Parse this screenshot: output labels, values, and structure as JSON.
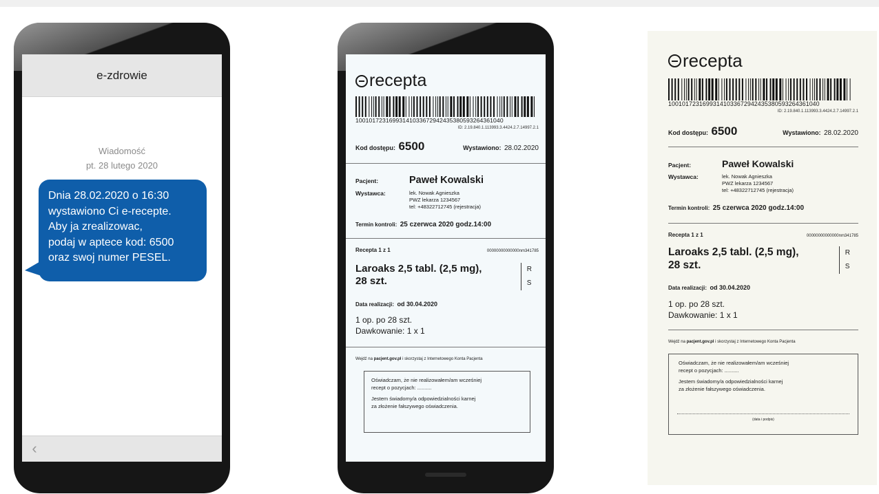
{
  "sms": {
    "header_title": "e-zdrowie",
    "meta_label": "Wiadomość",
    "meta_date": "pt. 28 lutego 2020",
    "message_lines": [
      "Dnia 28.02.2020 o 16:30",
      "wystawiono Ci e-recepte.",
      "Aby ja zrealizowac,",
      "podaj w aptece kod: 6500",
      "oraz swoj numer PESEL."
    ],
    "back_icon": "‹"
  },
  "prescription": {
    "logo_text": "recepta",
    "barcode_number": "1001017231699314103367294243538059326436104​0",
    "barcode_id": "ID: 2.19.840.1.113993.3.4424.2.7.14997.2.1",
    "access_code_label": "Kod dostępu:",
    "access_code": "6500",
    "issued_label": "Wystawiono:",
    "issued_date": "28.02.2020",
    "patient_label": "Pacjent:",
    "patient_name": "Paweł Kowalski",
    "issuer_label": "Wystawca:",
    "issuer_lines": [
      "lek. Nowak Agnieszka",
      "PWZ lekarza 1234567",
      "tel: +48322712745 (rejestracja)"
    ],
    "control_label": "Termin kontroli:",
    "control_date": "25 czerwca 2020 godz.14:00",
    "recipe_label": "Recepta 1 z 1",
    "recipe_code": "00000000000000nm341785",
    "drug_line1": "Laroaks 2,5 tabl. (2,5 mg),",
    "drug_line2": "28 szt.",
    "rs_r": "R",
    "rs_s": "S",
    "realization_label": "Data realizacji:",
    "realization_date": "od 30.04.2020",
    "pack_text": "1 op. po 28 szt.",
    "dosage_text": "Dawkowanie: 1 x 1",
    "footer_pre": "Wejdź na",
    "footer_link": "pacjent.gov.pl",
    "footer_post": "i skorzystaj z Internetowego Konta Pacjenta",
    "decl_line1": "Oświadczam, że nie realizowałem/am wcześniej",
    "decl_line2": "recept o pozycjach: ..........",
    "decl_line3": "Jestem świadomy/a odpowiedzialności karnej",
    "decl_line4": "za złożenie fałszywego oświadczenia.",
    "sign_label": "(data i podpis)"
  }
}
